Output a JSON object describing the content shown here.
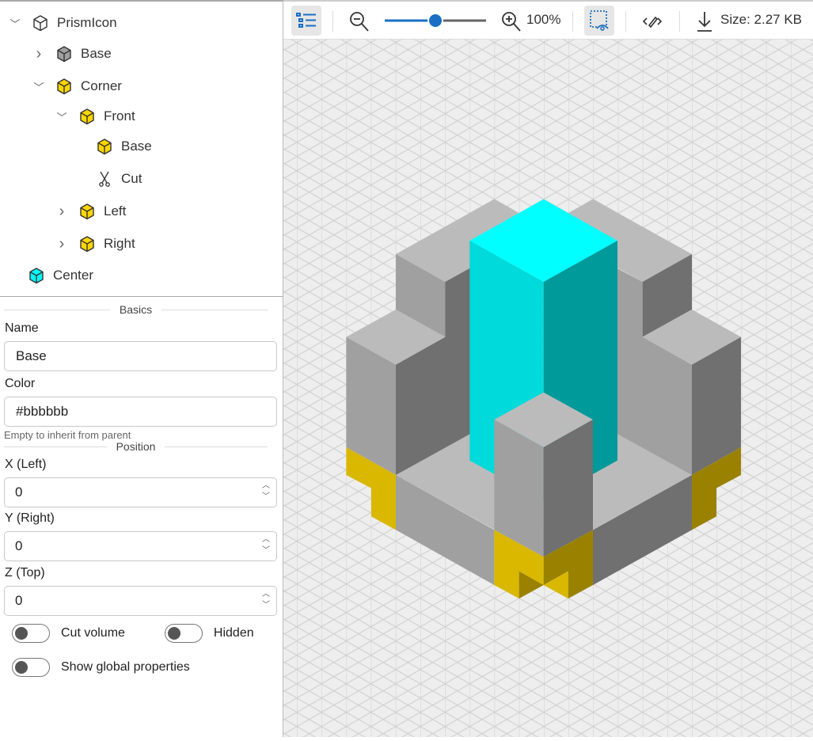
{
  "tree": [
    {
      "label": "PrismIcon",
      "expander": "expanded",
      "icon": "outline-cube-icon",
      "color": "#ffffff"
    },
    {
      "label": "Base",
      "expander": "collapsed",
      "icon": "cube-icon",
      "color": "#a0a0a0"
    },
    {
      "label": "Corner",
      "expander": "expanded",
      "icon": "cube-icon",
      "color": "#ffd700"
    },
    {
      "label": "Front",
      "expander": "expanded",
      "icon": "cube-icon",
      "color": "#ffd700"
    },
    {
      "label": "Base",
      "expander": "none",
      "icon": "cube-icon",
      "color": "#ffd700"
    },
    {
      "label": "Cut",
      "expander": "none",
      "icon": "scissors-icon",
      "color": ""
    },
    {
      "label": "Left",
      "expander": "collapsed",
      "icon": "cube-icon",
      "color": "#ffd700"
    },
    {
      "label": "Right",
      "expander": "collapsed",
      "icon": "cube-icon",
      "color": "#ffd700"
    },
    {
      "label": "Center",
      "expander": "none",
      "icon": "cube-icon",
      "color": "#00ffff"
    }
  ],
  "form": {
    "basics_section": "Basics",
    "name_label": "Name",
    "name_value": "Base",
    "color_label": "Color",
    "color_value": "#bbbbbb",
    "color_help": "Empty to inherit from parent",
    "position_section": "Position",
    "x_label": "X (Left)",
    "x_value": "0",
    "y_label": "Y (Right)",
    "y_value": "0",
    "z_label": "Z (Top)",
    "z_value": "0",
    "cut_volume_label": "Cut volume",
    "cut_volume_on": false,
    "hidden_label": "Hidden",
    "hidden_on": false,
    "global_label": "Show global properties",
    "global_on": false
  },
  "toolbar": {
    "zoom_value": "100%",
    "zoom_slider_percent": 50,
    "size_label": "Size: 2.27 KB"
  },
  "colors": {
    "accent": "#1a6fc4",
    "cyan": "#00ffff",
    "yellow": "#dab800",
    "grey": "#bbbbbb"
  }
}
